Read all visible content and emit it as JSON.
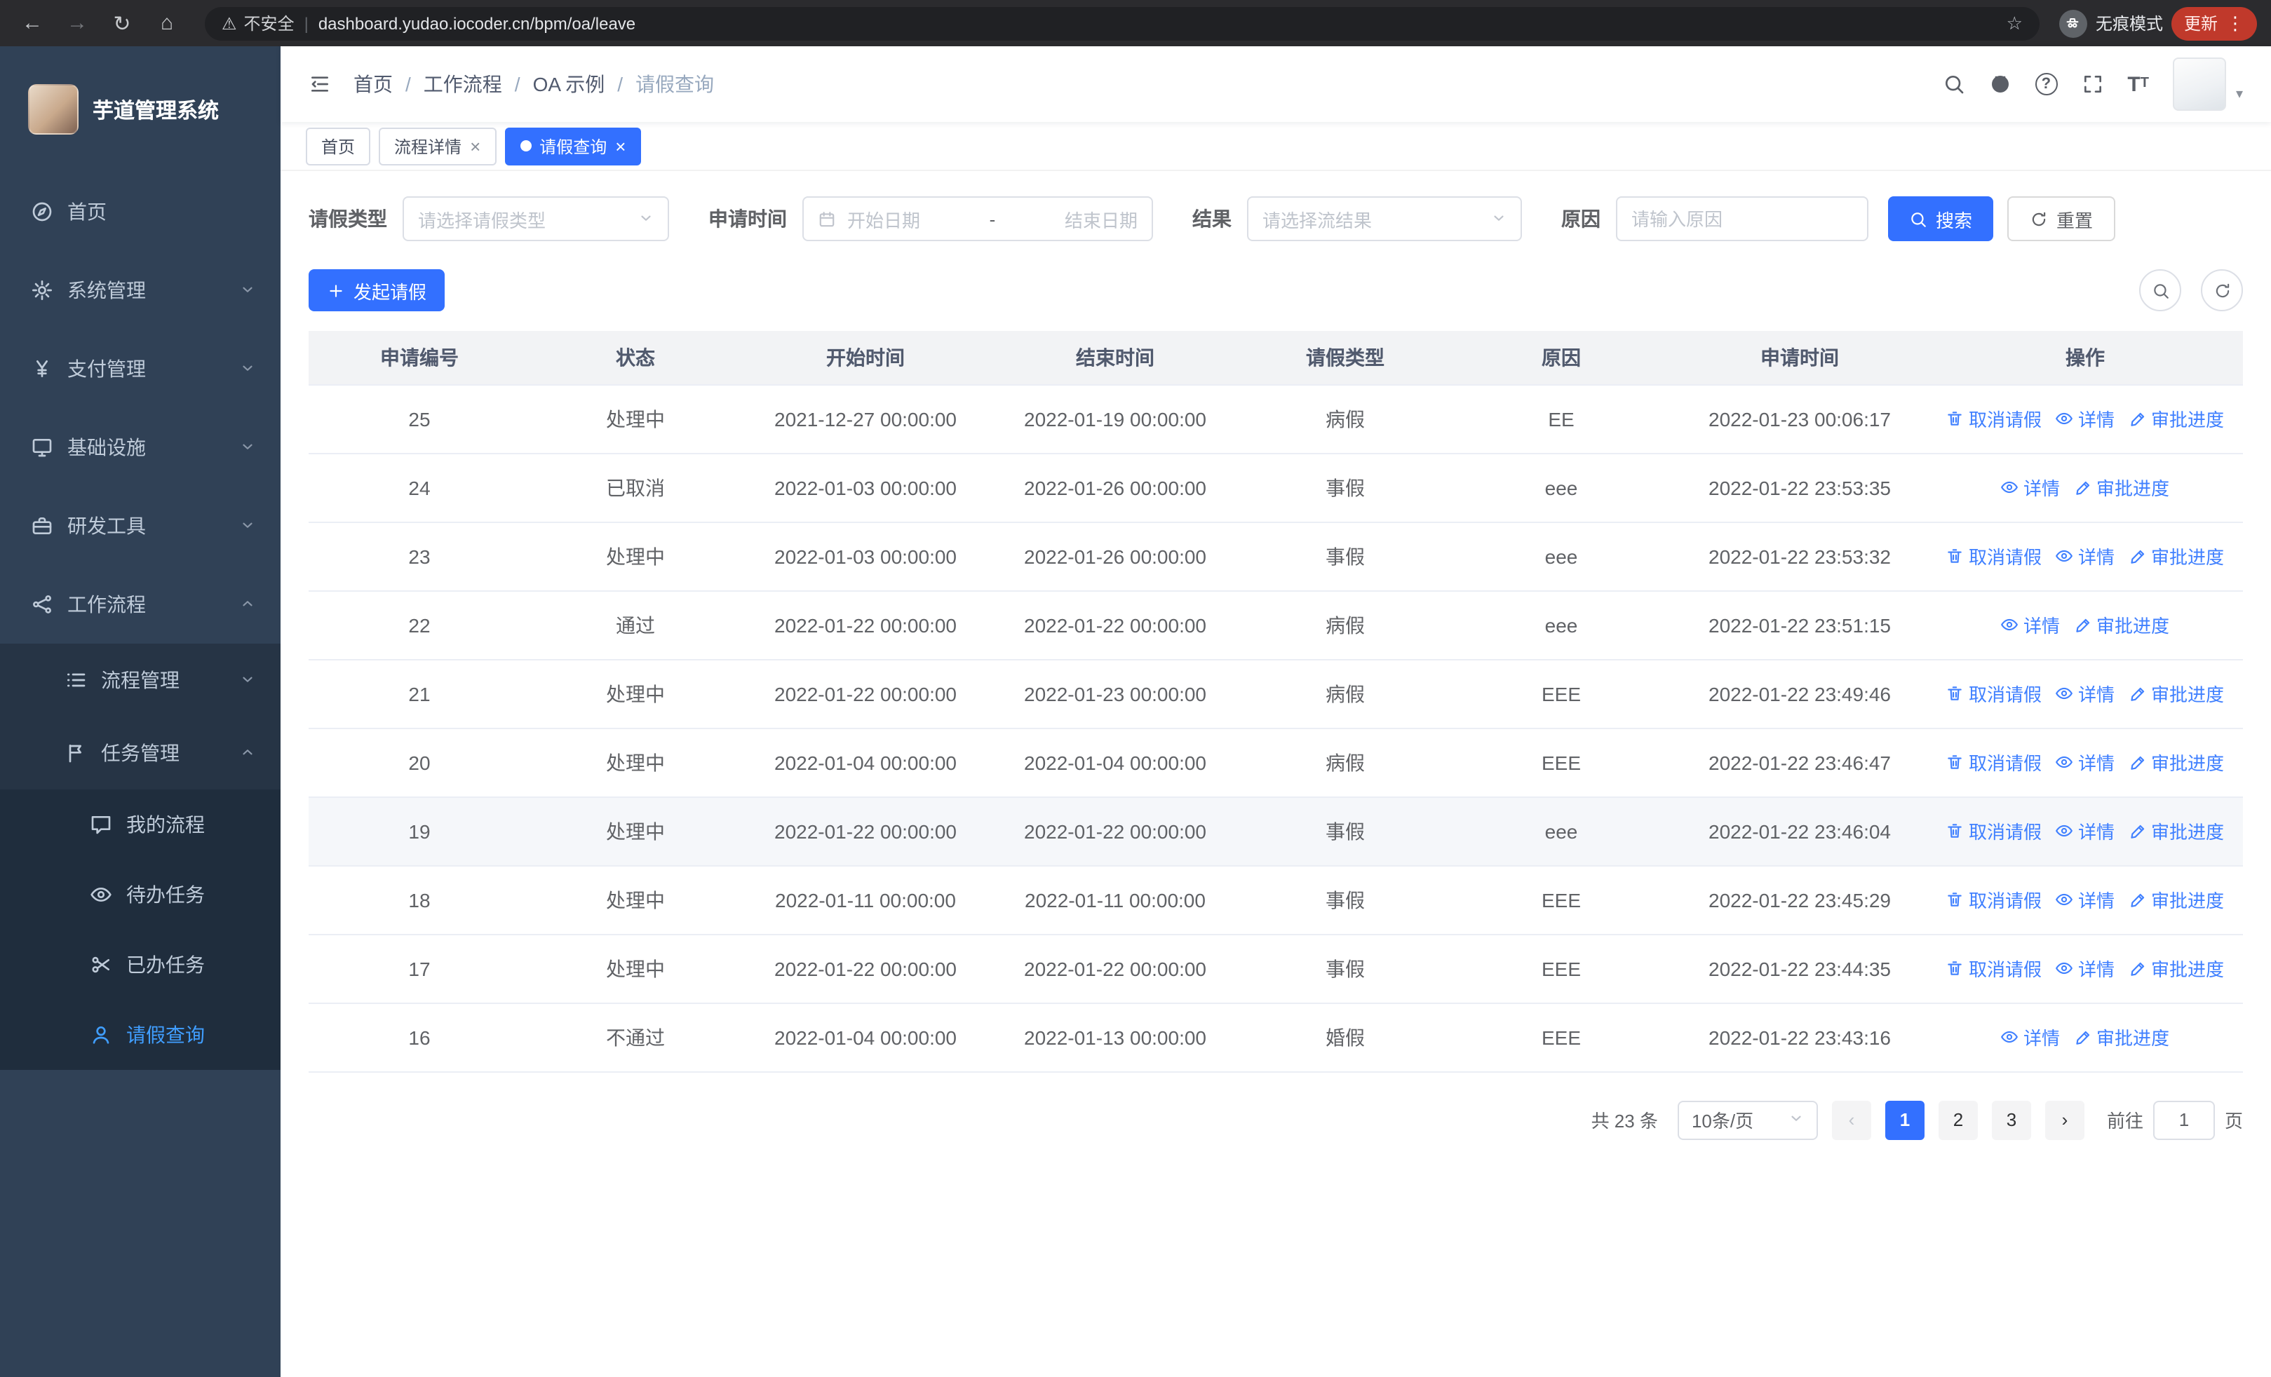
{
  "colors": {
    "accent": "#3370ff",
    "link": "#4080ff",
    "sidebar_bg": "#304156",
    "sidebar_submenu_bg": "#263445",
    "sidebar_active": "#409eff",
    "sidebar_text": "#bfcbd9",
    "update_chip": "#c0392b",
    "table_header_bg": "#f2f3f5",
    "row_hover_bg": "#f5f7fa"
  },
  "browser": {
    "security_label": "不安全",
    "url": "dashboard.yudao.iocoder.cn/bpm/oa/leave",
    "incognito_label": "无痕模式",
    "update_label": "更新"
  },
  "sidebar": {
    "logo_title": "芋道管理系统",
    "home": "首页",
    "system": "系统管理",
    "payment": "支付管理",
    "infrastructure": "基础设施",
    "devtools": "研发工具",
    "workflow": "工作流程",
    "process_management": "流程管理",
    "task_management": "任务管理",
    "my_process": "我的流程",
    "todo_tasks": "待办任务",
    "done_tasks": "已办任务",
    "leave_query": "请假查询"
  },
  "header": {
    "breadcrumb": [
      "首页",
      "工作流程",
      "OA 示例",
      "请假查询"
    ],
    "separator": "/"
  },
  "tabs": [
    {
      "label": "首页"
    },
    {
      "label": "流程详情"
    },
    {
      "label": "请假查询"
    }
  ],
  "filters": {
    "leave_type_label": "请假类型",
    "leave_type_placeholder": "请选择请假类型",
    "apply_time_label": "申请时间",
    "start_date_placeholder": "开始日期",
    "range_separator": "-",
    "end_date_placeholder": "结束日期",
    "result_label": "结果",
    "result_placeholder": "请选择流结果",
    "reason_label": "原因",
    "reason_placeholder": "请输入原因",
    "search_label": "搜索",
    "reset_label": "重置"
  },
  "toolbar": {
    "create_label": "发起请假"
  },
  "table": {
    "columns": [
      "申请编号",
      "状态",
      "开始时间",
      "结束时间",
      "请假类型",
      "原因",
      "申请时间",
      "操作"
    ],
    "column_keys": [
      "id",
      "status",
      "start_time",
      "end_time",
      "leave_type",
      "reason",
      "apply_time"
    ],
    "action_labels": {
      "cancel": "取消请假",
      "detail": "详情",
      "progress": "审批进度"
    },
    "rows": [
      {
        "id": "25",
        "status": "处理中",
        "start": "2021-12-27 00:00:00",
        "end": "2022-01-19 00:00:00",
        "type": "病假",
        "reason": "EE",
        "applied": "2022-01-23 00:06:17",
        "actions": [
          "cancel",
          "detail",
          "progress"
        ]
      },
      {
        "id": "24",
        "status": "已取消",
        "start": "2022-01-03 00:00:00",
        "end": "2022-01-26 00:00:00",
        "type": "事假",
        "reason": "eee",
        "applied": "2022-01-22 23:53:35",
        "actions": [
          "detail",
          "progress"
        ]
      },
      {
        "id": "23",
        "status": "处理中",
        "start": "2022-01-03 00:00:00",
        "end": "2022-01-26 00:00:00",
        "type": "事假",
        "reason": "eee",
        "applied": "2022-01-22 23:53:32",
        "actions": [
          "cancel",
          "detail",
          "progress"
        ]
      },
      {
        "id": "22",
        "status": "通过",
        "start": "2022-01-22 00:00:00",
        "end": "2022-01-22 00:00:00",
        "type": "病假",
        "reason": "eee",
        "applied": "2022-01-22 23:51:15",
        "actions": [
          "detail",
          "progress"
        ]
      },
      {
        "id": "21",
        "status": "处理中",
        "start": "2022-01-22 00:00:00",
        "end": "2022-01-23 00:00:00",
        "type": "病假",
        "reason": "EEE",
        "applied": "2022-01-22 23:49:46",
        "actions": [
          "cancel",
          "detail",
          "progress"
        ]
      },
      {
        "id": "20",
        "status": "处理中",
        "start": "2022-01-04 00:00:00",
        "end": "2022-01-04 00:00:00",
        "type": "病假",
        "reason": "EEE",
        "applied": "2022-01-22 23:46:47",
        "actions": [
          "cancel",
          "detail",
          "progress"
        ]
      },
      {
        "id": "19",
        "status": "处理中",
        "start": "2022-01-22 00:00:00",
        "end": "2022-01-22 00:00:00",
        "type": "事假",
        "reason": "eee",
        "applied": "2022-01-22 23:46:04",
        "actions": [
          "cancel",
          "detail",
          "progress"
        ],
        "hovered": true
      },
      {
        "id": "18",
        "status": "处理中",
        "start": "2022-01-11 00:00:00",
        "end": "2022-01-11 00:00:00",
        "type": "事假",
        "reason": "EEE",
        "applied": "2022-01-22 23:45:29",
        "actions": [
          "cancel",
          "detail",
          "progress"
        ]
      },
      {
        "id": "17",
        "status": "处理中",
        "start": "2022-01-22 00:00:00",
        "end": "2022-01-22 00:00:00",
        "type": "事假",
        "reason": "EEE",
        "applied": "2022-01-22 23:44:35",
        "actions": [
          "cancel",
          "detail",
          "progress"
        ]
      },
      {
        "id": "16",
        "status": "不通过",
        "start": "2022-01-04 00:00:00",
        "end": "2022-01-13 00:00:00",
        "type": "婚假",
        "reason": "EEE",
        "applied": "2022-01-22 23:43:16",
        "actions": [
          "detail",
          "progress"
        ]
      }
    ]
  },
  "pagination": {
    "total_label": "共 23 条",
    "page_size_label": "10条/页",
    "pages": [
      "1",
      "2",
      "3"
    ],
    "active_page": "1",
    "goto_label": "前往",
    "goto_value": "1",
    "goto_unit_label": "页"
  }
}
